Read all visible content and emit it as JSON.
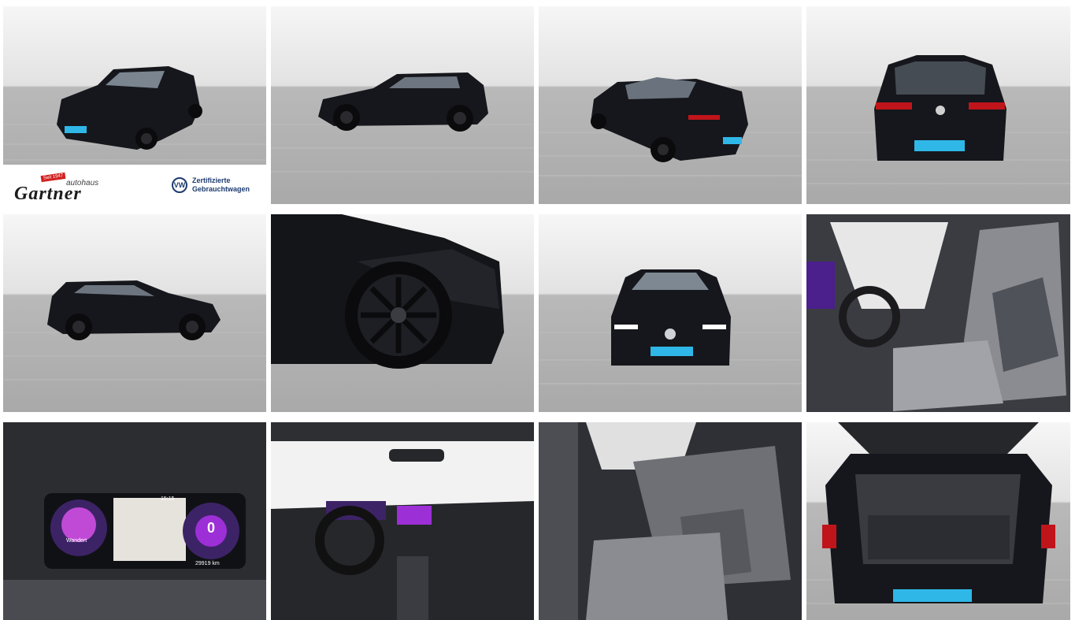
{
  "gallery": {
    "photos": [
      {
        "alt": "front-three-quarter"
      },
      {
        "alt": "side-profile"
      },
      {
        "alt": "rear-three-quarter"
      },
      {
        "alt": "rear"
      },
      {
        "alt": "side-right"
      },
      {
        "alt": "wheel"
      },
      {
        "alt": "front"
      },
      {
        "alt": "front-seats"
      },
      {
        "alt": "instrument-cluster"
      },
      {
        "alt": "cockpit"
      },
      {
        "alt": "rear-seats"
      },
      {
        "alt": "trunk"
      }
    ]
  },
  "dealer": {
    "badge": "Seit 1947",
    "small_label": "autohaus",
    "name": "Gartner",
    "vw_mark": "VW",
    "certified_line1": "Zertifizierte",
    "certified_line2": "Gebrauchtwagen"
  },
  "cluster": {
    "speed": "0",
    "range_label": "Wandert",
    "time": "15:15",
    "odometer": "29919 km"
  },
  "colors": {
    "car_body": "#15161b",
    "plate": "#2fb7e8",
    "floor": "#ababab",
    "sky": "#efefef",
    "vw_blue": "#1d3b6f"
  }
}
